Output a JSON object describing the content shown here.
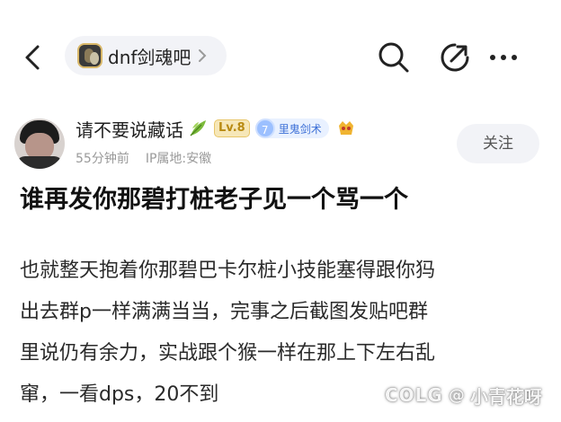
{
  "topbar": {
    "forum_name": "dnf剑魂吧",
    "icons": [
      "back-icon",
      "search-icon",
      "share-icon",
      "more-icon"
    ]
  },
  "author": {
    "name": "请不要说藏话",
    "level": "Lv.8",
    "badge_number": "7",
    "badge_text": "里鬼剑术",
    "time": "55分钟前",
    "ip_location": "IP属地:安徽",
    "follow_label": "关注"
  },
  "post": {
    "title": "谁再发你那碧打桩老子见一个骂一个",
    "body_lines": [
      "也就整天抱着你那碧巴卡尔桩小技能塞得跟你犸",
      "出去群p一样满满当当，完事之后截图发贴吧群",
      "里说仍有余力，实战跟个猴一样在那上下左右乱",
      "窜，一看dps，20不到"
    ]
  },
  "watermark": {
    "brand": "COLG",
    "at": "@",
    "user": "小青花呀"
  },
  "colors": {
    "level_badge": "#e8c66a",
    "tag_badge": "#9cc0ff",
    "pill_bg": "#f2f3f7"
  }
}
